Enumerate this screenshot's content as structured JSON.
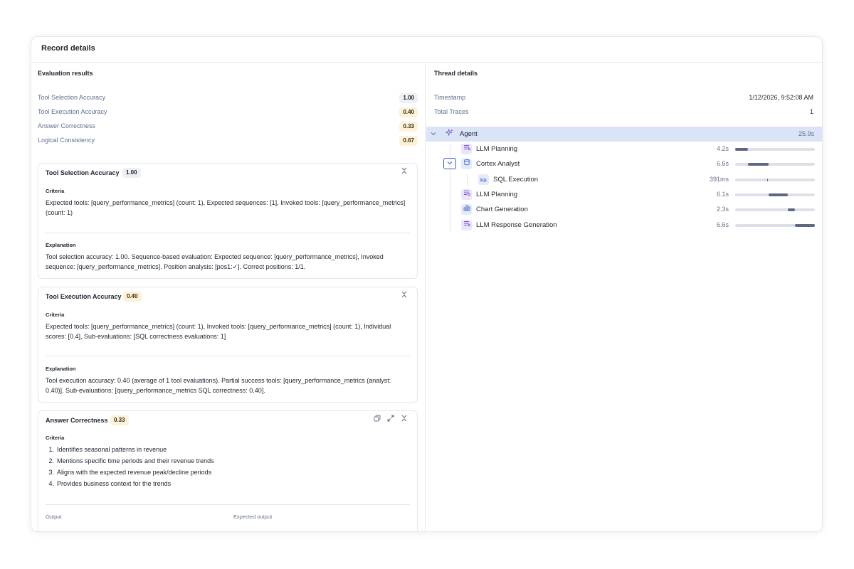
{
  "card": {
    "title": "Record details"
  },
  "evaluation": {
    "title": "Evaluation results",
    "metrics": [
      {
        "name": "Tool Selection Accuracy",
        "score": "1.00"
      },
      {
        "name": "Tool Execution Accuracy",
        "score": "0.40"
      },
      {
        "name": "Answer Correctness",
        "score": "0.33"
      },
      {
        "name": "Logical Consistency",
        "score": "0.67"
      }
    ],
    "cards": [
      {
        "title": "Tool Selection Accuracy",
        "score": "1.00",
        "criteria_label": "Criteria",
        "criteria": "Expected tools: [query_performance_metrics] (count: 1), Expected sequences: [1], Invoked tools: [query_performance_metrics] (count: 1)",
        "explanation_label": "Explanation",
        "explanation": "Tool selection accuracy: 1.00. Sequence-based evaluation: Expected sequence: [query_performance_metrics], Invoked sequence: [query_performance_metrics]. Position analysis: [pos1:✓]. Correct positions: 1/1."
      },
      {
        "title": "Tool Execution Accuracy",
        "score": "0.40",
        "criteria_label": "Criteria",
        "criteria": "Expected tools: [query_performance_metrics] (count: 1), Invoked tools: [query_performance_metrics] (count: 1), Individual scores: [0.4], Sub-evaluations: [SQL correctness evaluations: 1]",
        "explanation_label": "Explanation",
        "explanation": "Tool execution accuracy: 0.40 (average of 1 tool evaluations). Partial success tools: [query_performance_metrics (analyst: 0.40)]. Sub-evaluations: [query_performance_metrics SQL correctness: 0.40]."
      },
      {
        "title": "Answer Correctness",
        "score": "0.33",
        "criteria_label": "Criteria",
        "criteria_items": [
          "Identifies seasonal patterns in revenue",
          "Mentions specific time periods and their revenue trends",
          "Aligns with the expected revenue peak/decline periods",
          "Provides business context for the trends"
        ],
        "output_label": "Output",
        "expected_output_label": "Expected output"
      }
    ]
  },
  "thread": {
    "title": "Thread details",
    "timestamp_label": "Timestamp",
    "timestamp_value": "1/12/2026, 9:52:08 AM",
    "traces_label": "Total Traces",
    "traces_value": "1",
    "traces": [
      {
        "name": "Agent",
        "duration": "25.9s",
        "icon": "sparkle-icon",
        "start": 0,
        "width": 1
      },
      {
        "name": "LLM Planning",
        "duration": "4.2s",
        "icon": "llm-icon",
        "start": 0.0,
        "width": 0.16
      },
      {
        "name": "Cortex Analyst",
        "duration": "6.6s",
        "icon": "database-icon",
        "start": 0.16,
        "width": 0.26
      },
      {
        "name": "SQL Execution",
        "duration": "391ms",
        "icon": "sql-icon",
        "start": 0.4,
        "width": 0.015
      },
      {
        "name": "LLM Planning",
        "duration": "6.1s",
        "icon": "llm-icon",
        "start": 0.42,
        "width": 0.24
      },
      {
        "name": "Chart Generation",
        "duration": "2.3s",
        "icon": "chart-icon",
        "start": 0.66,
        "width": 0.09
      },
      {
        "name": "LLM Response Generation",
        "duration": "6.6s",
        "icon": "llm-icon",
        "start": 0.75,
        "width": 0.25
      }
    ]
  }
}
